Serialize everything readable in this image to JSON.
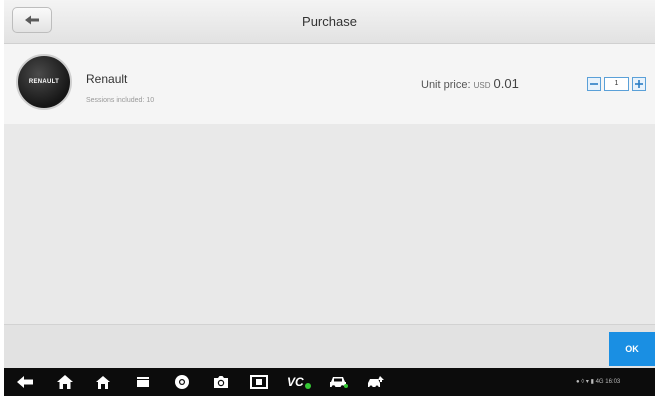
{
  "header": {
    "title": "Purchase",
    "back_icon": "back-arrow-icon"
  },
  "item": {
    "logo_text": "RENAULT",
    "name": "Renault",
    "sessions": "Sessions included: 10",
    "unit_price_label": "Unit price:",
    "currency": "USD",
    "price": "0.01",
    "quantity": "1"
  },
  "footer": {
    "ok_label": "OK"
  },
  "navbar": {
    "icons": [
      "back-icon",
      "home-icon",
      "house-icon",
      "recent-apps-icon",
      "chrome-icon",
      "camera-icon",
      "screen-capture-icon",
      "vci-icon",
      "car-icon",
      "vehicle-repair-icon"
    ],
    "vc_label": "VC",
    "status_text": "4G 16:03"
  },
  "colors": {
    "accent": "#1a8fe3",
    "stepper_border": "#5aa0d8",
    "navbar": "#0c0c0c",
    "vci_green": "#35c935"
  }
}
